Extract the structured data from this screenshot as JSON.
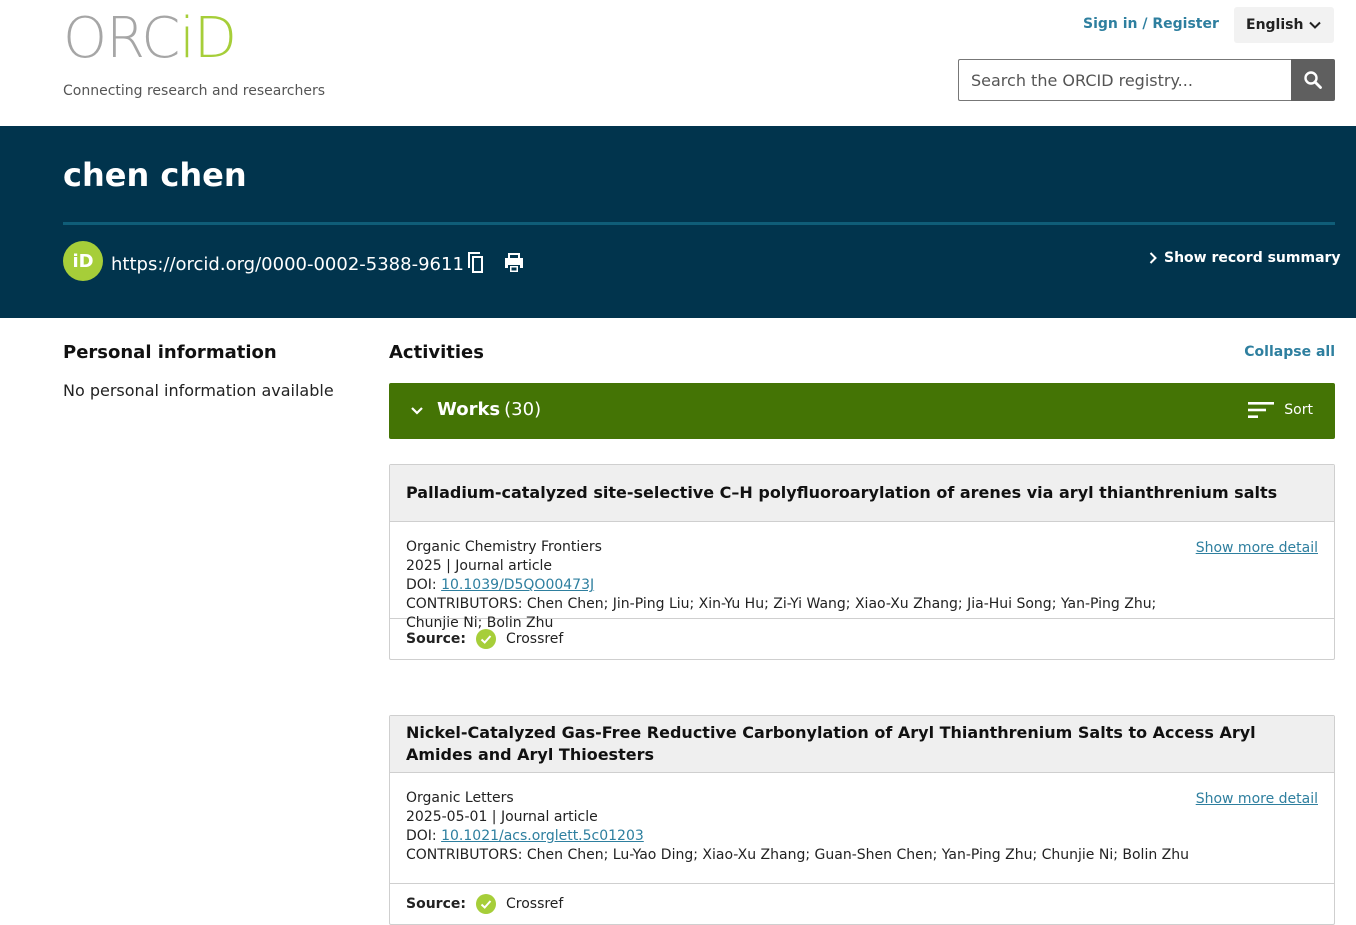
{
  "header": {
    "logo_part1": "ORC",
    "logo_part2": "iD",
    "tagline": "Connecting research and researchers",
    "signin_label": "Sign in / Register",
    "language": "English",
    "search_placeholder": "Search the ORCID registry..."
  },
  "banner": {
    "name": "chen chen",
    "id_badge": "iD",
    "orcid_url": "https://orcid.org/0000-0002-5388-9611",
    "summary_label": "Show record summary"
  },
  "personal": {
    "title": "Personal information",
    "text": "No personal information available"
  },
  "activities": {
    "title": "Activities",
    "collapse_label": "Collapse all",
    "works_label": "Works",
    "works_count": "(30)",
    "sort_label": "Sort"
  },
  "works": [
    {
      "title": "Palladium-catalyzed site-selective C–H polyfluoroarylation of arenes via aryl thianthrenium salts",
      "journal": "Organic Chemistry Frontiers",
      "date_type": "2025 | Journal article",
      "doi_label": "DOI: ",
      "doi": "10.1039/D5QO00473J",
      "contributors": "CONTRIBUTORS: Chen Chen; Jin-Ping Liu; Xin-Yu Hu; Zi-Yi Wang; Xiao-Xu Zhang; Jia-Hui Song; Yan-Ping Zhu; Chunjie Ni; Bolin Zhu",
      "more_label": "Show more detail",
      "source_label": "Source",
      "source": "Crossref"
    },
    {
      "title": "Nickel-Catalyzed Gas-Free Reductive Carbonylation of Aryl Thianthrenium Salts to Access Aryl Amides and Aryl Thioesters",
      "journal": "Organic Letters",
      "date_type": "2025-05-01 | Journal article",
      "doi_label": "DOI: ",
      "doi": "10.1021/acs.orglett.5c01203",
      "contributors": "CONTRIBUTORS: Chen Chen; Lu-Yao Ding; Xiao-Xu Zhang; Guan-Shen Chen; Yan-Ping Zhu; Chunjie Ni; Bolin Zhu",
      "more_label": "Show more detail",
      "source_label": "Source",
      "source": "Crossref"
    }
  ],
  "colors": {
    "banner": "#01344d",
    "works_bar": "#447405",
    "orcid_green": "#a6ce39",
    "link": "#2e7f9f"
  }
}
